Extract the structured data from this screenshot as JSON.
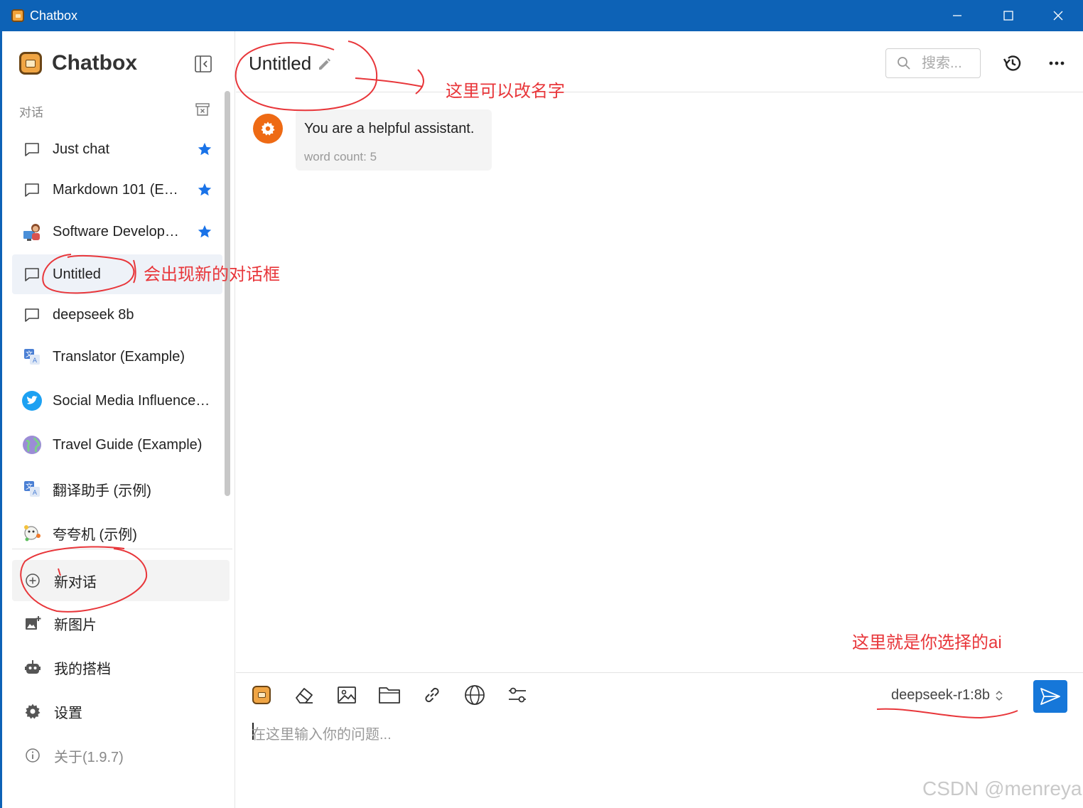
{
  "window": {
    "title": "Chatbox",
    "buttons": [
      "minimize",
      "maximize",
      "close"
    ]
  },
  "sidebar": {
    "brand": "Chatbox",
    "section_label": "对话",
    "conversations": [
      {
        "label": "Just chat",
        "icon": "chat-bubble-icon",
        "starred": true
      },
      {
        "label": "Markdown 101 (E…",
        "icon": "chat-bubble-icon",
        "starred": true
      },
      {
        "label": "Software Develop…",
        "icon": "developer-avatar-icon",
        "starred": true
      },
      {
        "label": "Untitled",
        "icon": "chat-bubble-icon",
        "starred": false,
        "active": true
      },
      {
        "label": "deepseek 8b",
        "icon": "chat-bubble-icon",
        "starred": false
      },
      {
        "label": "Translator (Example)",
        "icon": "translate-icon",
        "starred": false
      },
      {
        "label": "Social Media Influence…",
        "icon": "twitter-icon",
        "starred": false
      },
      {
        "label": "Travel Guide (Example)",
        "icon": "globe-avatar-icon",
        "starred": false
      },
      {
        "label": "翻译助手 (示例)",
        "icon": "translate-icon",
        "starred": false
      },
      {
        "label": "夸夸机 (示例)",
        "icon": "praise-bot-icon",
        "starred": false
      }
    ],
    "nav": {
      "new_chat": "新对话",
      "new_image": "新图片",
      "my_partners": "我的搭档",
      "settings": "设置",
      "about": "关于(1.9.7)"
    }
  },
  "header": {
    "chat_title": "Untitled",
    "search_placeholder": "搜索..."
  },
  "messages": [
    {
      "role": "system",
      "text": "You are a helpful assistant.",
      "meta": "word count: 5"
    }
  ],
  "composer": {
    "placeholder": "在这里输入你的问题...",
    "model": "deepseek-r1:8b",
    "tools": [
      "chatbox-logo-icon",
      "eraser-icon",
      "image-icon",
      "folder-icon",
      "link-icon",
      "globe-icon",
      "sliders-icon"
    ]
  },
  "annotations": {
    "rename_hint": "这里可以改名字",
    "new_dialog_hint": "会出现新的对话框",
    "model_hint": "这里就是你选择的ai"
  },
  "watermark": "CSDN @menreya",
  "colors": {
    "titlebar": "#0d62b6",
    "accent": "#1677d9",
    "star": "#1a73e8",
    "annotation": "#e8363a",
    "system_avatar": "#ee6a14"
  }
}
